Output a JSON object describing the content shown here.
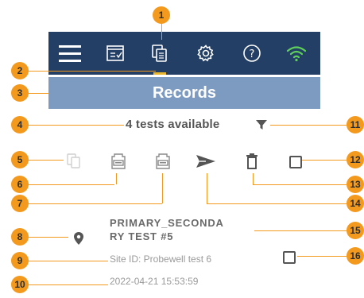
{
  "toolbar": {
    "icons": [
      "menu-icon",
      "checklist-icon",
      "records-icon",
      "gear-icon",
      "help-icon",
      "wifi-icon"
    ],
    "active_indicator_color": "#e7b62e",
    "background_color": "#233f66",
    "wifi_color": "#5fd15a"
  },
  "title_bar": {
    "title": "Records",
    "background_color": "#7d9ac1"
  },
  "summary": {
    "tests_available": "4 tests available"
  },
  "record_actions": [
    "copy-icon",
    "sd-card-icon",
    "sd-card-icon",
    "send-icon",
    "trash-icon",
    "select-all-checkbox"
  ],
  "records": [
    {
      "title": "PRIMARY_SECONDARY TEST #5",
      "title_line1": "PRIMARY_SECONDA",
      "title_line2": "RY TEST #5",
      "site": "Site ID: Probewell test 6",
      "datetime": "2022-04-21 15:53:59"
    }
  ],
  "callouts": [
    "1",
    "2",
    "3",
    "4",
    "5",
    "6",
    "7",
    "8",
    "9",
    "10",
    "11",
    "12",
    "13",
    "14",
    "15",
    "16"
  ],
  "callout_color": "#f39a1e"
}
